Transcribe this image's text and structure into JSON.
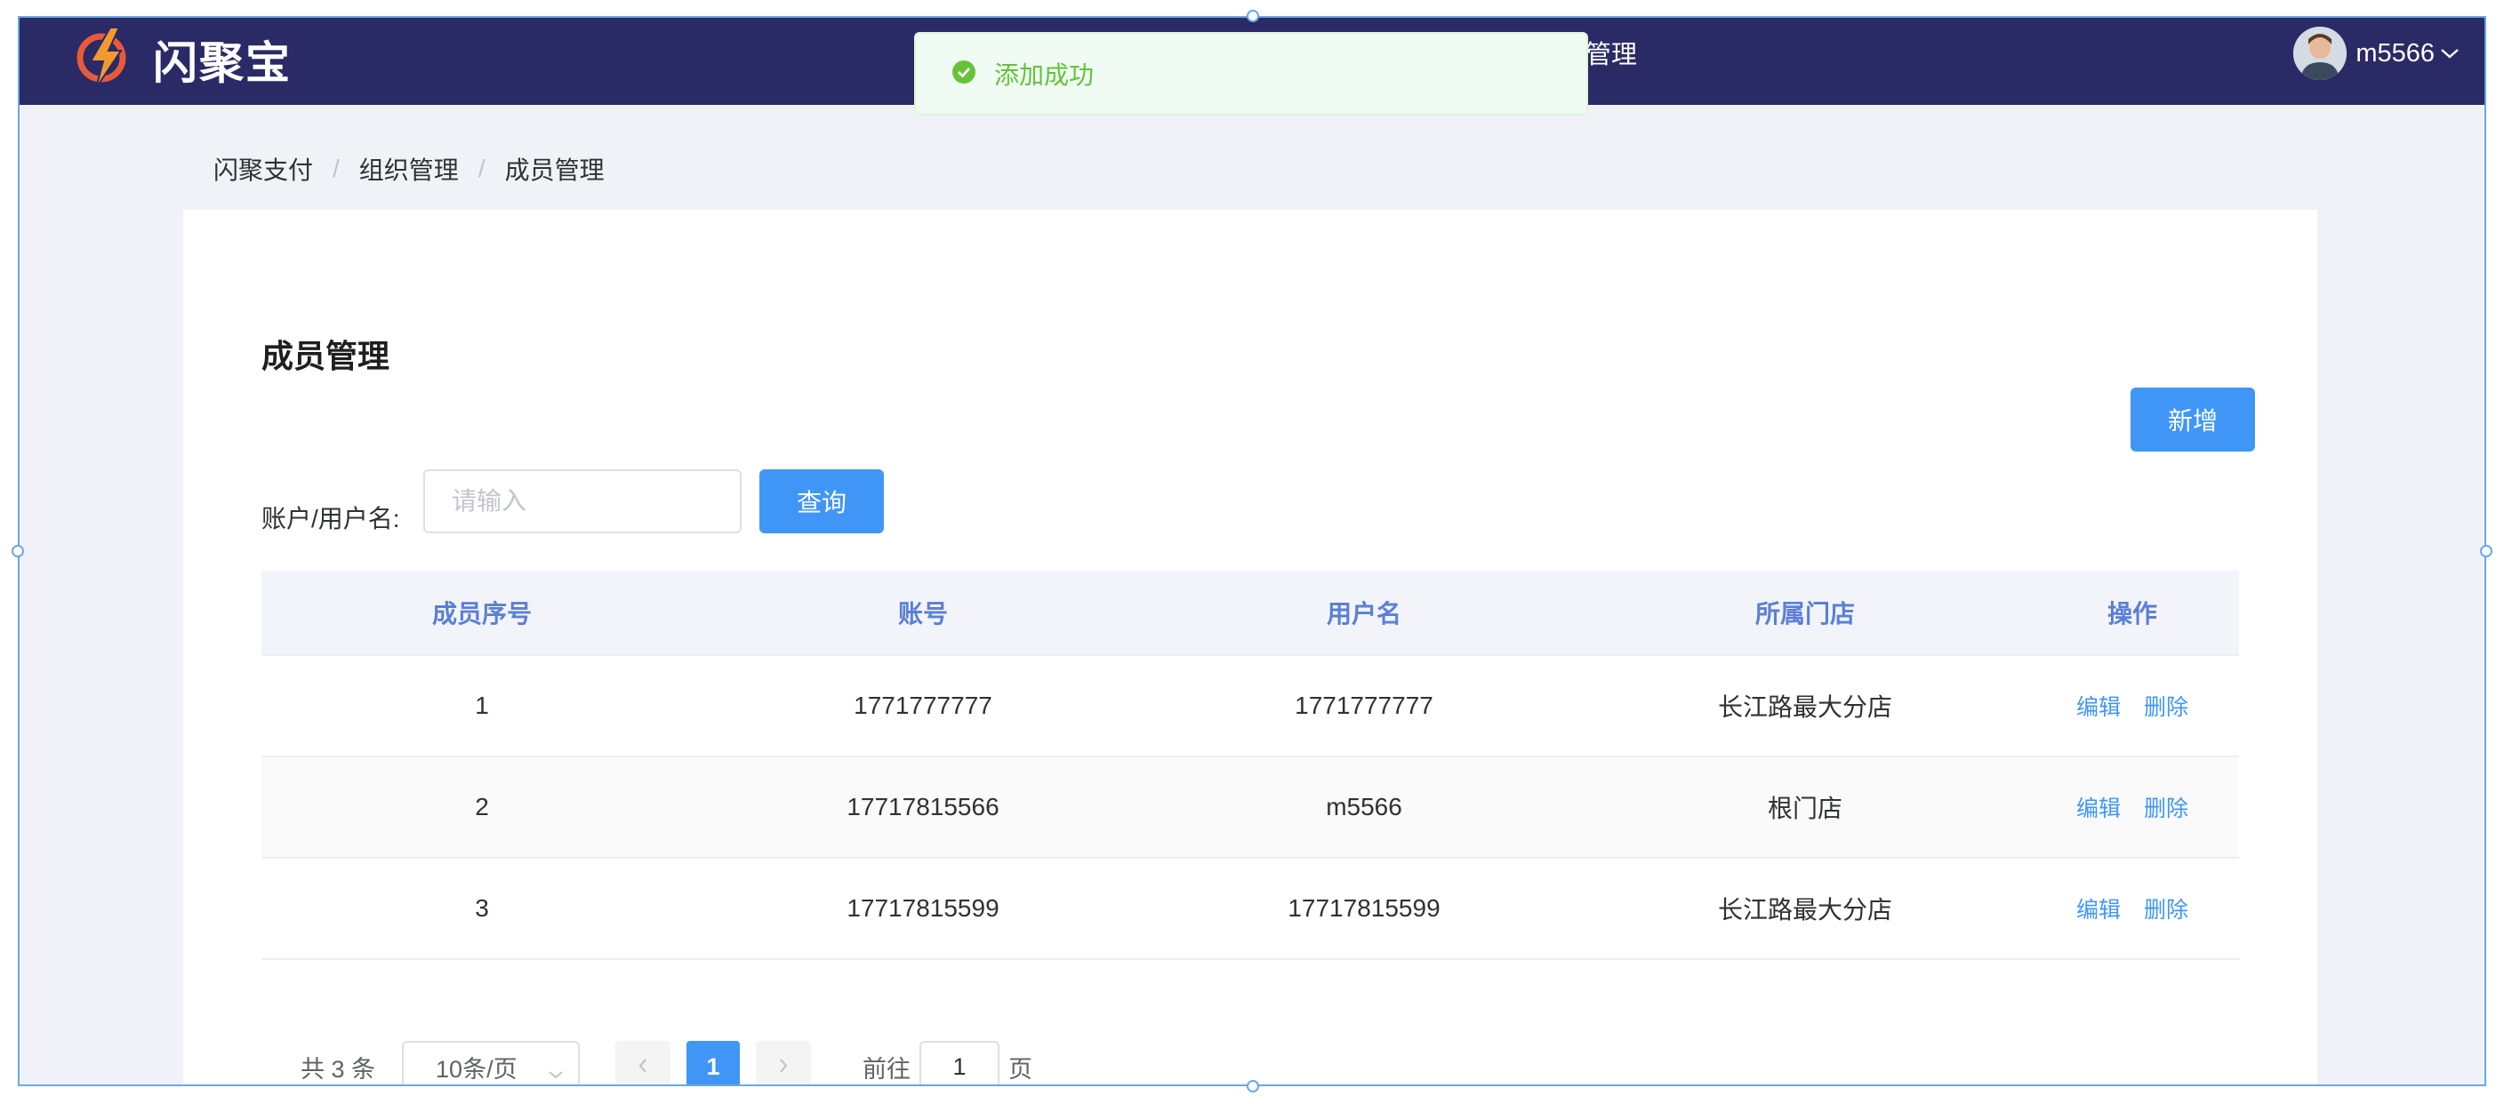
{
  "header": {
    "logo_text": "闪聚宝",
    "nav_partial": "织管理",
    "username": "m5566"
  },
  "toast": {
    "message": "添加成功",
    "color": "#67c23a"
  },
  "breadcrumb": [
    "闪聚支付",
    "组织管理",
    "成员管理"
  ],
  "main": {
    "title": "成员管理",
    "add_label": "新增",
    "search_label": "账户/用户名:",
    "search_placeholder": "请输入",
    "search_value": "",
    "query_label": "查询"
  },
  "table": {
    "columns": [
      "成员序号",
      "账号",
      "用户名",
      "所属门店",
      "操作"
    ],
    "rows": [
      {
        "index": "1",
        "account": "1771777777",
        "username": "1771777777",
        "store": "长江路最大分店",
        "edit": "编辑",
        "delete": "删除"
      },
      {
        "index": "2",
        "account": "17717815566",
        "username": "m5566",
        "store": "根门店",
        "edit": "编辑",
        "delete": "删除"
      },
      {
        "index": "3",
        "account": "17717815599",
        "username": "17717815599",
        "store": "长江路最大分店",
        "edit": "编辑",
        "delete": "删除"
      }
    ]
  },
  "pagination": {
    "total_text": "共 3 条",
    "page_size": "10条/页",
    "current_page": "1",
    "goto_label": "前往",
    "goto_value": "1",
    "goto_suffix": "页"
  },
  "colors": {
    "header_bg": "#2a2a66",
    "primary": "#4096f7",
    "table_header_text": "#5b7fd6"
  }
}
